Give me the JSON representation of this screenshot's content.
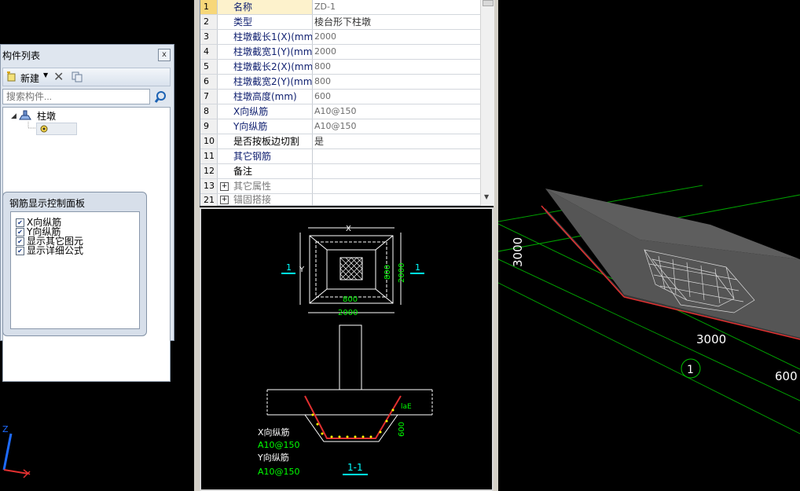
{
  "component_panel": {
    "title": "构件列表",
    "close_label": "x",
    "toolbar": {
      "new_label": "新建"
    },
    "search": {
      "placeholder": "搜索构件..."
    },
    "tree": {
      "root_label": "柱墩"
    }
  },
  "rebar_panel": {
    "title": "钢筋显示控制面板",
    "options": [
      {
        "label": "X向纵筋",
        "checked": true
      },
      {
        "label": "Y向纵筋",
        "checked": true
      },
      {
        "label": "显示其它图元",
        "checked": true
      },
      {
        "label": "显示详细公式",
        "checked": true
      }
    ]
  },
  "properties": {
    "rows": [
      {
        "num": "1",
        "name": "名称",
        "value": "ZD-1"
      },
      {
        "num": "2",
        "name": "类型",
        "value": "棱台形下柱墩"
      },
      {
        "num": "3",
        "name": "柱墩截长1(X)(mm)",
        "value": "2000"
      },
      {
        "num": "4",
        "name": "柱墩截宽1(Y)(mm)",
        "value": "2000"
      },
      {
        "num": "5",
        "name": "柱墩截长2(X)(mm)",
        "value": "800"
      },
      {
        "num": "6",
        "name": "柱墩截宽2(Y)(mm)",
        "value": "800"
      },
      {
        "num": "7",
        "name": "柱墩高度(mm)",
        "value": "600"
      },
      {
        "num": "8",
        "name": "X向纵筋",
        "value": "A10@150"
      },
      {
        "num": "9",
        "name": "Y向纵筋",
        "value": "A10@150"
      },
      {
        "num": "10",
        "name": "是否按板边切割",
        "value": "是"
      },
      {
        "num": "11",
        "name": "其它钢筋",
        "value": ""
      },
      {
        "num": "12",
        "name": "备注",
        "value": ""
      },
      {
        "num": "13",
        "name": "其它属性",
        "value": ""
      },
      {
        "num": "21",
        "name": "锚固搭接",
        "value": ""
      }
    ]
  },
  "cad_drawing": {
    "plan_x_label": "X",
    "plan_y_label": "Y",
    "dim_800_h": "800",
    "dim_2000_h": "2000",
    "dim_800_v": "800",
    "dim_2000_v": "2000",
    "section_mark": "1",
    "section_title": "1-1",
    "lae": "laE",
    "dim_600": "600",
    "x_rebar_label": "X向纵筋",
    "x_rebar_value": "A10@150",
    "y_rebar_label": "Y向纵筋",
    "y_rebar_value": "A10@150"
  },
  "view3d": {
    "grid_label_3000_v": "3000",
    "grid_label_3000_h": "3000",
    "grid_label_600": "600",
    "axis_bubble": "1",
    "axis_z": "Z"
  },
  "colors": {
    "panel_bg": "#dfe6ef",
    "cad_green": "#00ff00",
    "cad_cyan": "#00ffff",
    "cad_yellow": "#ffff00",
    "slab_grey": "#4a4a4a"
  }
}
